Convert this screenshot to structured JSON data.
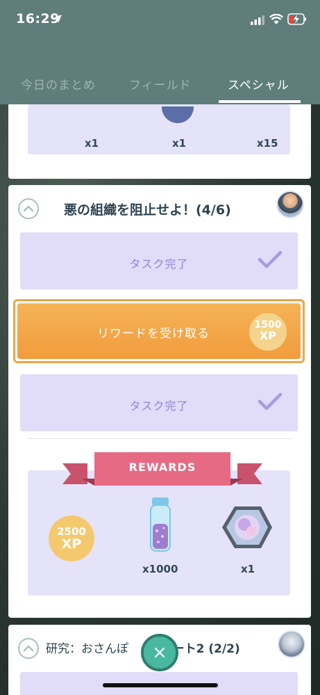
{
  "status_bar": {
    "time": "16:29"
  },
  "tabs": [
    {
      "label": "今日のまとめ",
      "active": false
    },
    {
      "label": "フィールド",
      "active": false
    },
    {
      "label": "スペシャル",
      "active": true
    }
  ],
  "prev_card": {
    "quantities": [
      "x1",
      "x1",
      "x15"
    ]
  },
  "quest_card": {
    "title": "悪の組織を阻止せよ！(4/6)",
    "task_done_label_1": "タスク完了",
    "claim_button_label": "リワードを受け取る",
    "claim_xp": {
      "amount": "1500",
      "unit": "XP"
    },
    "task_done_label_2": "タスク完了",
    "rewards_banner": "REWARDS",
    "rewards": {
      "xp": {
        "amount": "2500",
        "unit": "XP"
      },
      "stardust_qty": "x1000",
      "incense_qty": "x1"
    }
  },
  "next_card": {
    "title_prefix": "研究：おさんぽ",
    "title_suffix": "うパート2 (2/2)"
  },
  "colors": {
    "header": "#5f7d7b",
    "task_done_bg": "#e1dcf8",
    "claim_orange": "#f19c3d",
    "xp_gold": "#f4c96e",
    "ribbon_pink": "#e66a84",
    "fab_teal": "#49b8a0"
  }
}
